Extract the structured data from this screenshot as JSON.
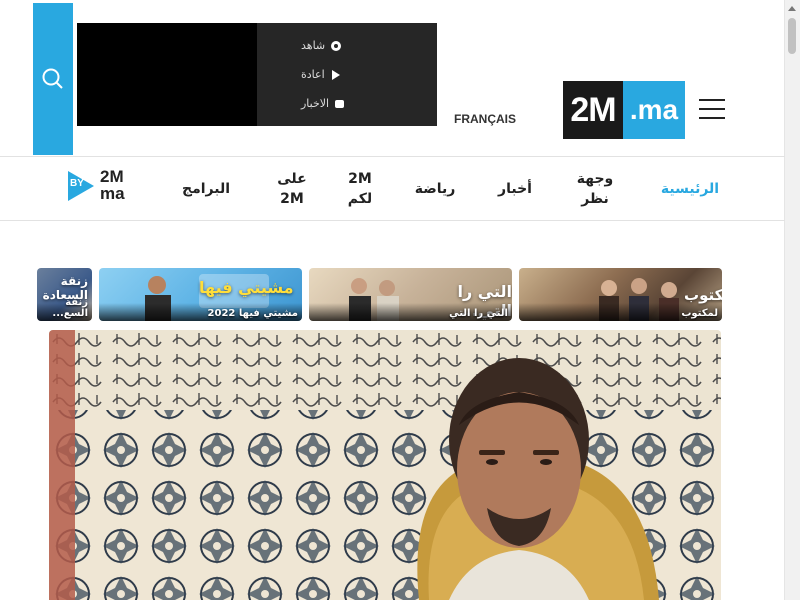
{
  "header": {
    "live_menu": [
      {
        "label": "شاهد",
        "icon": "circle-icon"
      },
      {
        "label": "اعادة",
        "icon": "play-icon"
      },
      {
        "label": "الاخبار",
        "icon": "tv-icon"
      }
    ],
    "language_link": "FRANÇAIS",
    "logo": {
      "part1": "2M",
      "part2": ".ma"
    },
    "colors": {
      "brand_blue": "#29a8e0",
      "dark": "#1a1a1a",
      "live_box": "#262626"
    }
  },
  "nav": {
    "items": [
      {
        "label": "الرئيسية",
        "active": true
      },
      {
        "label": "وجهة نظر",
        "active": false
      },
      {
        "label": "أخبار",
        "active": false
      },
      {
        "label": "رياضة",
        "active": false
      },
      {
        "label": "2M لكم",
        "active": false
      },
      {
        "label": "على 2M",
        "active": false
      },
      {
        "label": "البرامج",
        "active": false
      }
    ],
    "by_logo": {
      "by": "BY",
      "line1": "2M",
      "line2": "ma"
    }
  },
  "carousel": {
    "items": [
      {
        "title": "مكتوب",
        "caption": "لمكتوب"
      },
      {
        "title": "التي را التي...",
        "caption": "التي را التي"
      },
      {
        "title": "مشيتي فيها",
        "caption": "مشيتي فيها 2022"
      },
      {
        "title": "زنقة السعادة",
        "caption": "زنقة السع..."
      }
    ]
  },
  "hero": {
    "image": "portrait-photo"
  }
}
